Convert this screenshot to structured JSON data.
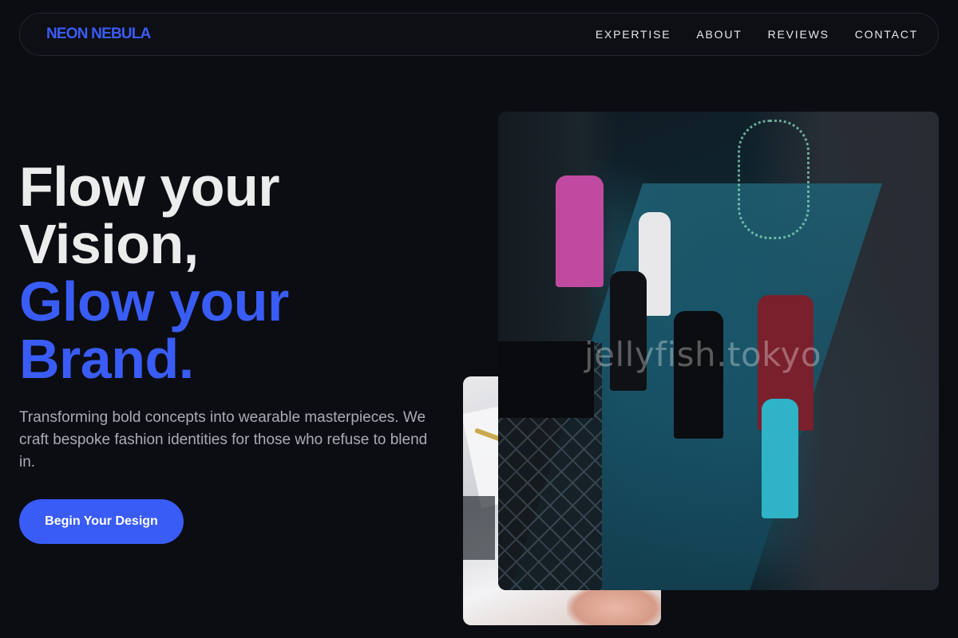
{
  "brand": {
    "name": "NEON NEBULA"
  },
  "nav": {
    "links": [
      {
        "label": "EXPERTISE"
      },
      {
        "label": "ABOUT"
      },
      {
        "label": "REVIEWS"
      },
      {
        "label": "CONTACT"
      }
    ]
  },
  "hero": {
    "title_line1": "Flow your",
    "title_line2": "Vision,",
    "title_line3": "Glow your",
    "title_line4": "Brand.",
    "subtitle": "Transforming bold concepts into wearable masterpieces. We craft bespoke fashion identities for those who refuse to blend in.",
    "cta_label": "Begin Your Design"
  },
  "images": {
    "front_watermark": "jellyfish.tokyo",
    "front_alt": "fashion-runway-photo",
    "back_alt": "design-studio-photo"
  },
  "colors": {
    "background": "#0b0d12",
    "accent": "#3a5cf6",
    "heading": "#ececec",
    "body_text": "#a9acb3"
  }
}
